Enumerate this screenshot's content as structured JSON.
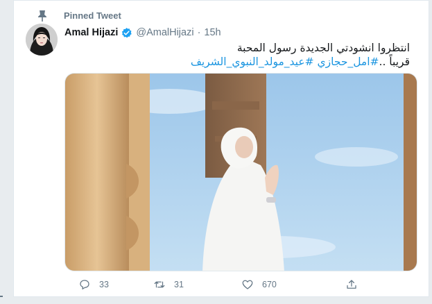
{
  "pinned_label": "Pinned Tweet",
  "tweet": {
    "display_name": "Amal Hijazi",
    "handle": "@AmalHijazi",
    "separator": "·",
    "time": "15h",
    "text_line1": "انتظروا انشودتي الجديدة رسول المحبة",
    "text_line2_prefix": "قريباً ..",
    "hashtag1": "#امل_حجازي",
    "hashtag2": "#عيد_مولد_النبوي_الشريف"
  },
  "stats": {
    "replies": "33",
    "retweets": "31",
    "likes": "670"
  },
  "icons": {
    "pin": "pin-icon",
    "verified": "verified-badge-icon",
    "reply": "reply-icon",
    "retweet": "retweet-icon",
    "like": "heart-icon",
    "share": "share-icon"
  },
  "colors": {
    "accent": "#1da1f2",
    "hashtag": "#1b95e0",
    "muted": "#657786",
    "text": "#14171a"
  }
}
